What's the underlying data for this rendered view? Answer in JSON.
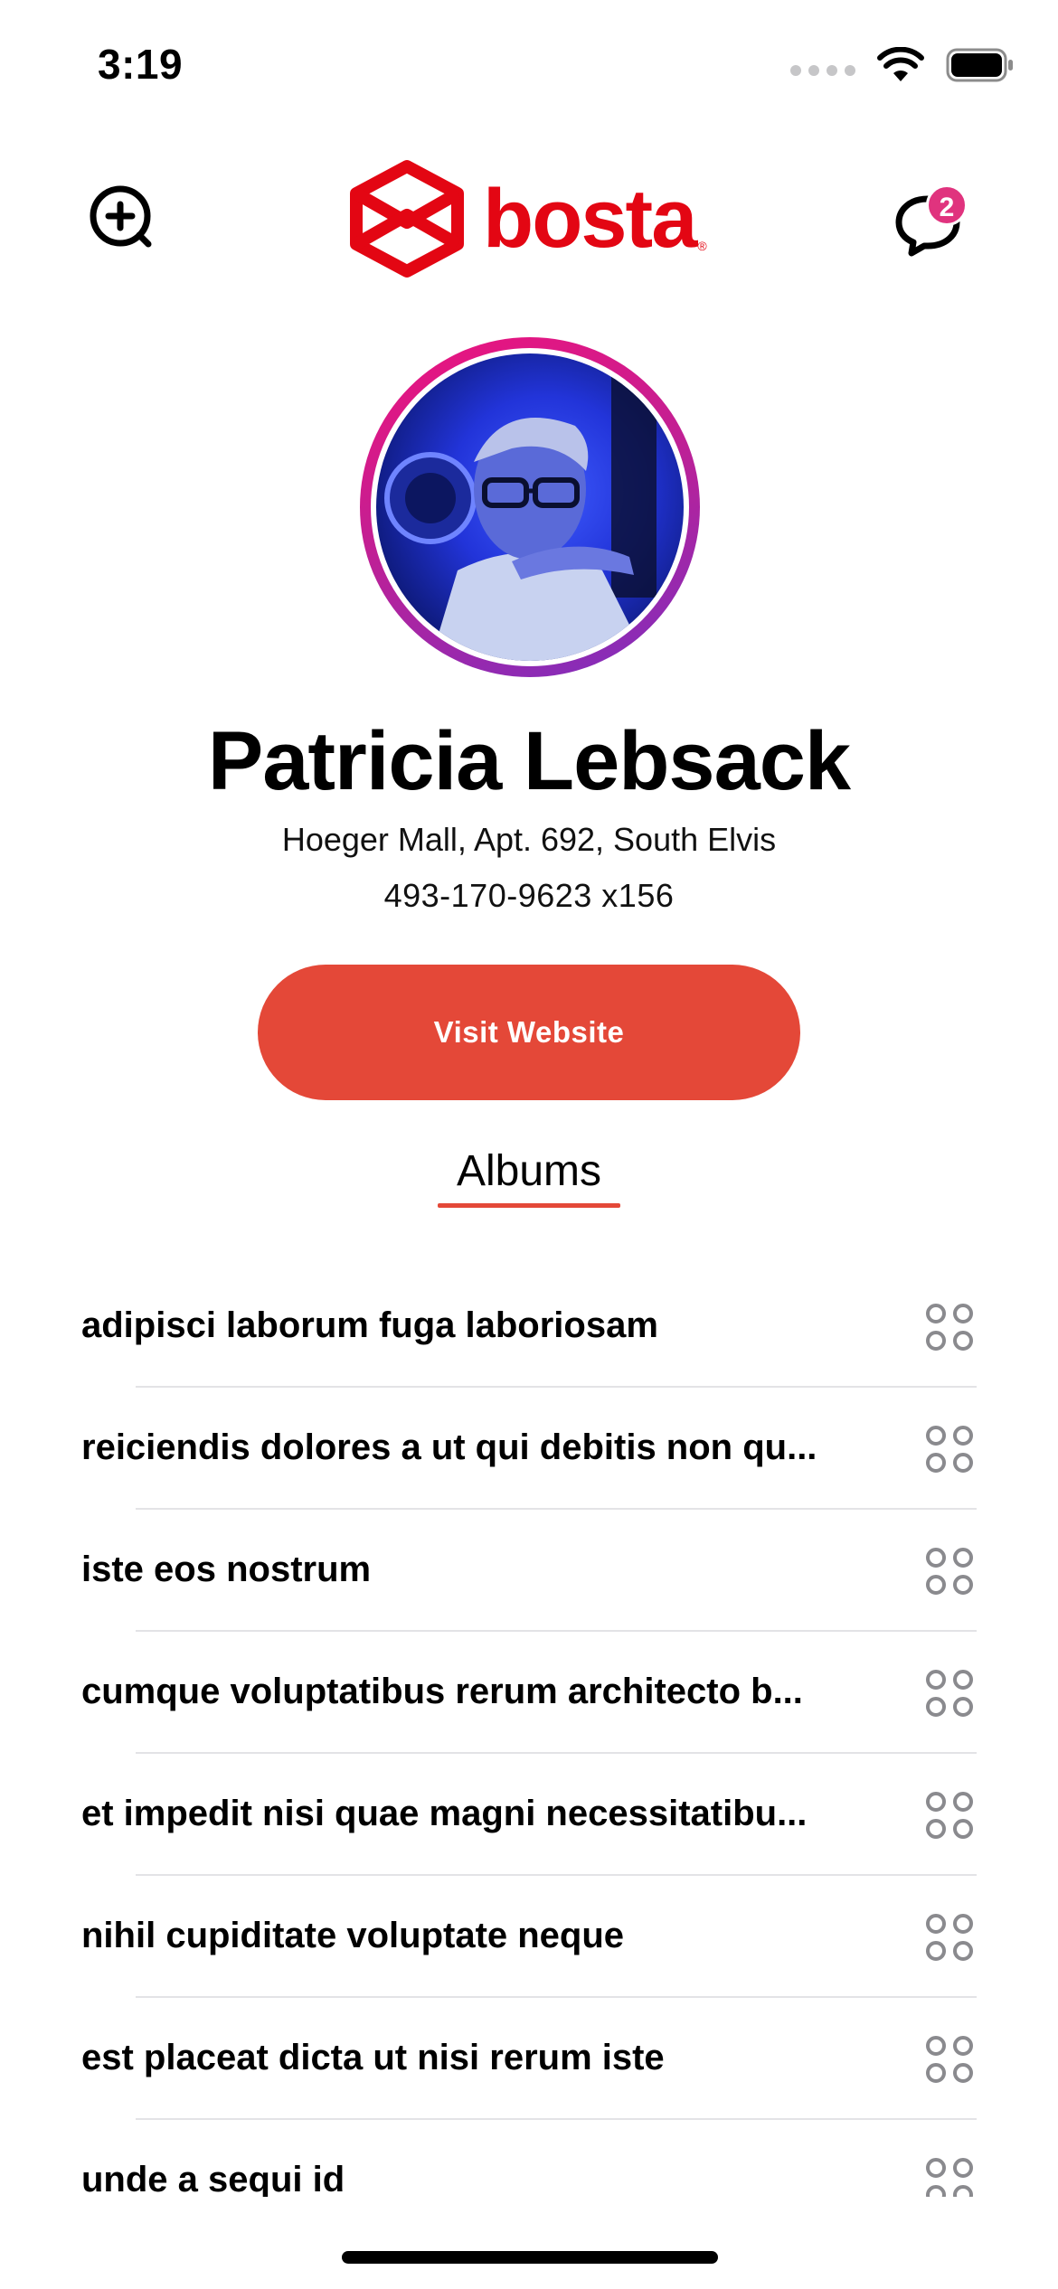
{
  "status_bar": {
    "time": "3:19"
  },
  "header": {
    "logo_text": "bosta",
    "logo_mark": "®",
    "chat_badge_count": "2",
    "brand_color": "#e30613"
  },
  "profile": {
    "name": "Patricia Lebsack",
    "address": "Hoeger Mall, Apt. 692, South Elvis",
    "phone": "493-170-9623 x156",
    "visit_label": "Visit Website",
    "button_color": "#e44838"
  },
  "tabs": {
    "albums_label": "Albums"
  },
  "albums": [
    "adipisci laborum fuga laboriosam",
    "reiciendis dolores a ut qui debitis non qu...",
    "iste eos nostrum",
    "cumque voluptatibus rerum architecto b...",
    "et impedit nisi quae magni necessitatibu...",
    "nihil cupiditate voluptate neque",
    "est placeat dicta ut nisi rerum iste",
    "unde a sequi id"
  ],
  "icons": {
    "add": "plus-circle-icon",
    "chat": "chat-bubble-icon",
    "album": "four-circles-grid-icon"
  }
}
